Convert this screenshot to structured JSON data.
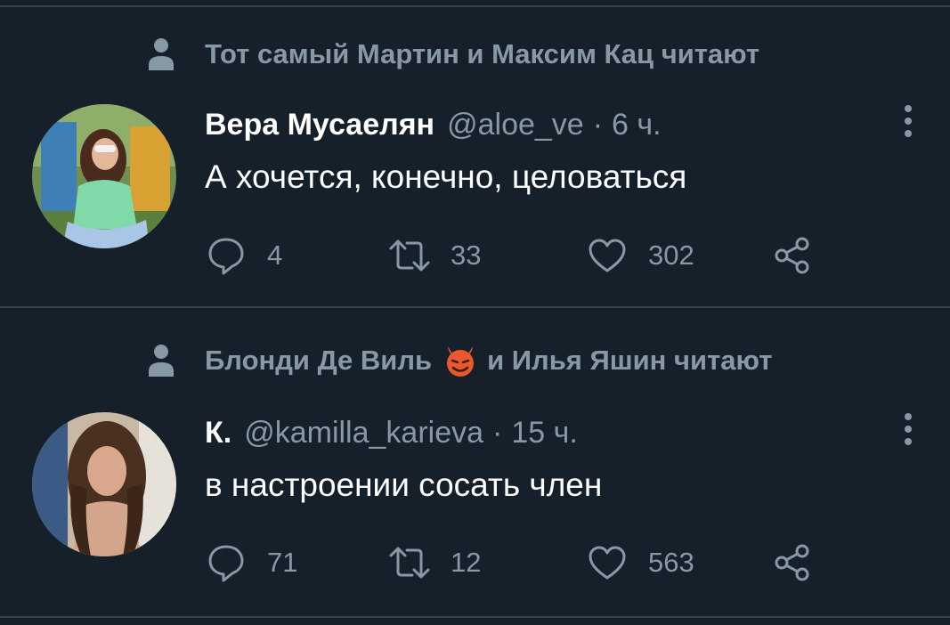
{
  "tweets": [
    {
      "social_context": "Тот самый Мартин и Максим Кац читают",
      "display_name": "Вера Мусаелян",
      "handle": "@aloe_ve",
      "separator": "·",
      "time": "6 ч.",
      "text": "А хочется, конечно, целоваться",
      "replies": "4",
      "retweets": "33",
      "likes": "302"
    },
    {
      "social_context_before": "Блонди Де Виль",
      "social_context_emoji": "smiling-devil-emoji",
      "social_context_after": "и Илья Яшин читают",
      "display_name": "К.",
      "handle": "@kamilla_karieva",
      "separator": "·",
      "time": "15 ч.",
      "text": "в настроении сосать член",
      "replies": "71",
      "retweets": "12",
      "likes": "563"
    }
  ],
  "icons": {
    "context": "person-icon",
    "more": "vertical-dots-icon",
    "reply": "speech-bubble-icon",
    "retweet": "retweet-arrows-icon",
    "like": "heart-icon",
    "share": "share-nodes-icon"
  },
  "colors": {
    "background": "#15202b",
    "divider": "#38444d",
    "text_primary": "#ffffff",
    "text_secondary": "#8899a6"
  }
}
